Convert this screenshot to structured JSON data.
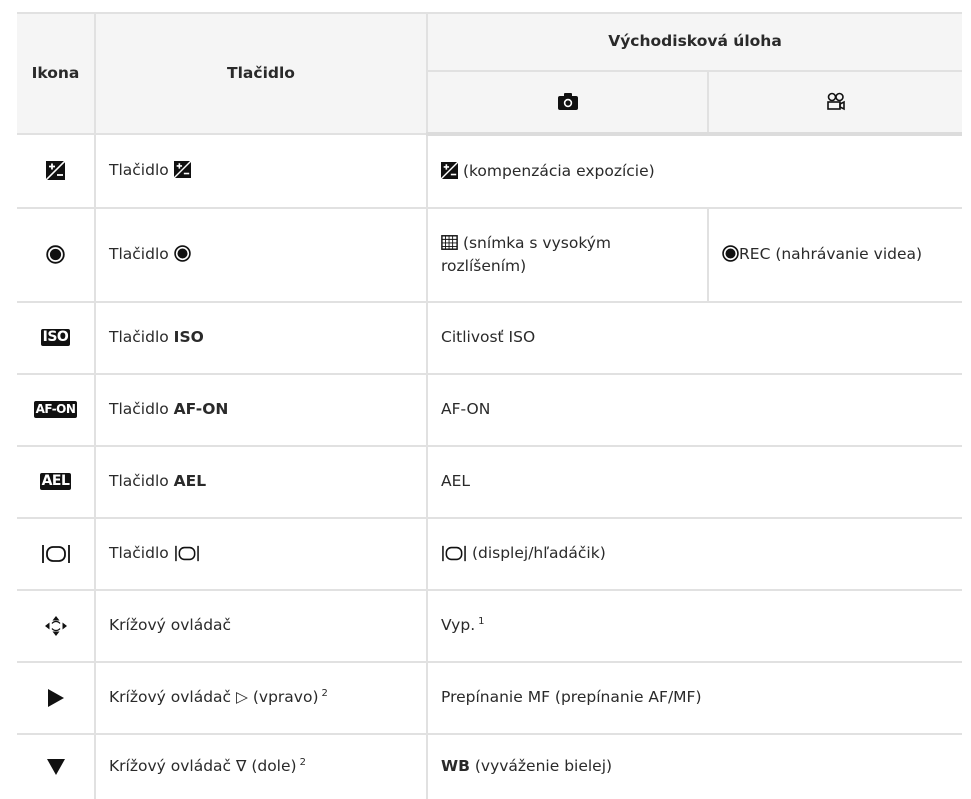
{
  "header": {
    "col_icon": "Ikona",
    "col_button": "Tlačidlo",
    "col_default": "Východisková úloha",
    "sub_photo_icon": "camera-icon",
    "sub_video_icon": "movie-camera-icon"
  },
  "rows": [
    {
      "icon": "exposure-compensation-icon",
      "button_prefix": "Tlačidlo",
      "button_bold": "",
      "function": "(kompenzácia expozície)"
    },
    {
      "icon": "record-icon",
      "button_prefix": "Tlačidlo",
      "button_bold": "",
      "function_photo": "(snímka s vysokým rozlíšením)",
      "function_video": "REC (nahrávanie videa)"
    },
    {
      "icon": "iso-icon",
      "icon_text": "ISO",
      "button_prefix": "Tlačidlo",
      "button_bold": "ISO",
      "function": "Citlivosť ISO"
    },
    {
      "icon": "af-on-icon",
      "icon_text": "AF-ON",
      "button_prefix": "Tlačidlo",
      "button_bold": "AF-ON",
      "function": "AF-ON"
    },
    {
      "icon": "ael-icon",
      "icon_text": "AEL",
      "button_prefix": "Tlačidlo",
      "button_bold": "AEL",
      "function": "AEL"
    },
    {
      "icon": "lv-display-icon",
      "button_prefix": "Tlačidlo",
      "button_bold": "",
      "function": "(displej/hľadáčik)"
    },
    {
      "icon": "multi-selector-icon",
      "button_prefix": "Krížový ovládač",
      "button_bold": "",
      "function": "Vyp.",
      "function_note": "1"
    },
    {
      "icon": "play-right-icon",
      "button_prefix": "Krížový ovládač",
      "button_symbol": "▷",
      "button_suffix": "(vpravo)",
      "button_note": "2",
      "function": "Prepínanie MF (prepínanie AF/MF)"
    },
    {
      "icon": "down-arrow-icon",
      "button_prefix": "Krížový ovládač",
      "button_symbol": "∇",
      "button_suffix": "(dole)",
      "button_note": "2",
      "function_bold": "WB",
      "function": "(vyváženie bielej)"
    }
  ],
  "colors": {
    "border": "#e1e1e1",
    "header_bg": "#f5f5f5",
    "text": "#2a2a2a",
    "icon": "#111111"
  }
}
